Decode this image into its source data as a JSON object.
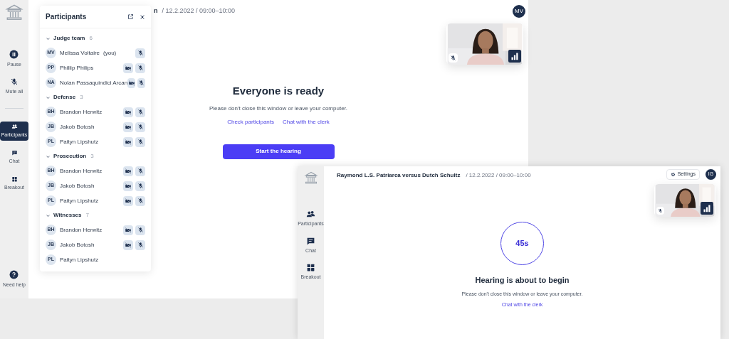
{
  "window_1": {
    "title_fragment": "n",
    "meta": "/ 12.2.2022 / 09:00–10:00",
    "avatar": "MV",
    "controls": [
      {
        "kind": "pause",
        "label": "Pause"
      },
      {
        "kind": "mute",
        "label": "Mute all"
      }
    ],
    "nav": [
      {
        "kind": "participants",
        "label": "Participants",
        "selected": true
      },
      {
        "kind": "chat",
        "label": "Chat",
        "selected": false
      },
      {
        "kind": "breakout",
        "label": "Breakout",
        "selected": false
      }
    ],
    "help": {
      "label": "Need help"
    },
    "participants_panel": {
      "title": "Participants",
      "groups": [
        {
          "name": "Judge team",
          "count": "6",
          "expanded": true,
          "members": [
            {
              "initials": "MV",
              "name": "Melissa Voltaire",
              "note": "(you)",
              "camera_off": false,
              "mic_off": true
            },
            {
              "initials": "PP",
              "name": "Phillip Philips",
              "camera_off": true,
              "mic_off": true
            },
            {
              "initials": "NA",
              "name": "Nolan Passaquindici Arcan",
              "camera_off": true,
              "mic_off": true
            }
          ]
        },
        {
          "name": "Defense",
          "count": "3",
          "expanded": true,
          "members": [
            {
              "initials": "BH",
              "name": "Brandon Herwitz",
              "camera_off": true,
              "mic_off": true
            },
            {
              "initials": "JB",
              "name": "Jakob Botosh",
              "camera_off": true,
              "mic_off": true
            },
            {
              "initials": "PL",
              "name": "Paityn Lipshutz",
              "camera_off": true,
              "mic_off": true
            }
          ]
        },
        {
          "name": "Prosecution",
          "count": "3",
          "expanded": true,
          "members": [
            {
              "initials": "BH",
              "name": "Brandon Herwitz",
              "camera_off": true,
              "mic_off": true
            },
            {
              "initials": "JB",
              "name": "Jakob Botosh",
              "camera_off": true,
              "mic_off": true
            },
            {
              "initials": "PL",
              "name": "Paityn Lipshutz",
              "camera_off": true,
              "mic_off": true
            }
          ]
        },
        {
          "name": "Witnesses",
          "count": "7",
          "expanded": true,
          "members": [
            {
              "initials": "BH",
              "name": "Brandon Herwitz",
              "camera_off": true,
              "mic_off": true
            },
            {
              "initials": "JB",
              "name": "Jakob Botosh",
              "camera_off": true,
              "mic_off": true
            },
            {
              "initials": "PL",
              "name": "Paityn Lipshutz",
              "camera_off": false,
              "mic_off": false
            }
          ]
        }
      ]
    },
    "video": {
      "kind": "picture"
    },
    "heading": "Everyone is ready",
    "message": "Please don't close this window or leave your computer.",
    "links": [
      "Check participants",
      "Chat with the clerk"
    ],
    "primary_button": "Start the hearing"
  },
  "window_2": {
    "title": "Raymond L.S. Patriarca versus Dutch Schultz",
    "meta": "/ 12.2.2022 / 09:00–10:00",
    "settings_button": "Settings",
    "avatar": "IG",
    "nav": [
      {
        "kind": "participants",
        "label": "Participants",
        "selected": false
      },
      {
        "kind": "chat",
        "label": "Chat",
        "selected": false
      },
      {
        "kind": "breakout",
        "label": "Breakout",
        "selected": false
      }
    ],
    "video": {
      "kind": "picture"
    },
    "countdown": "45s",
    "heading": "Hearing is about to begin",
    "message": "Please don't close this window or leave your computer.",
    "link": "Chat with the clerk"
  }
}
